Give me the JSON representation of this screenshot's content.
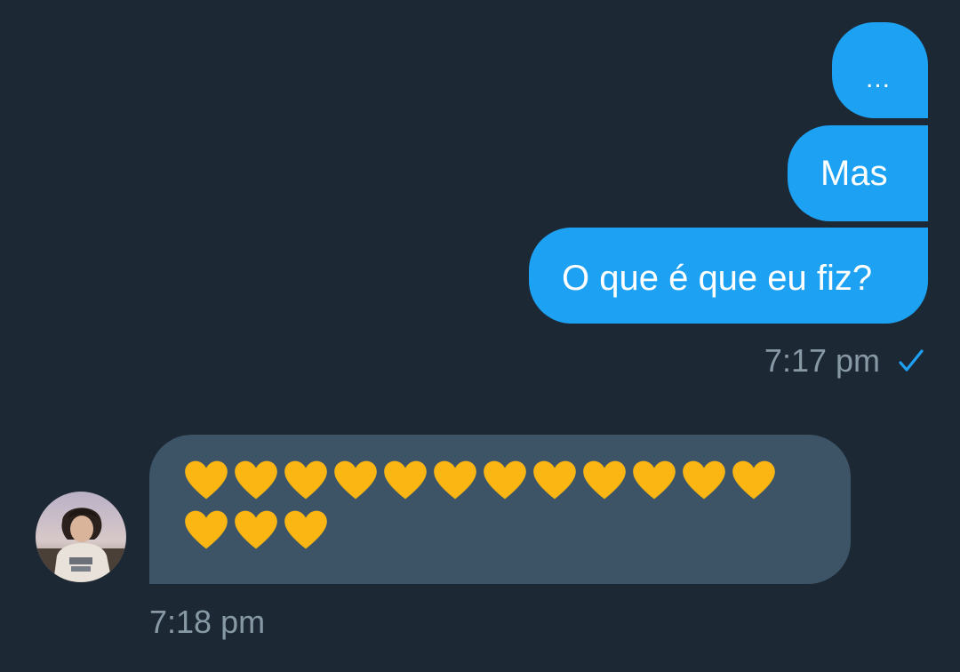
{
  "conversation": {
    "outgoing": {
      "messages": [
        "...",
        "Mas",
        "O que é que eu fiz?"
      ],
      "timestamp": "7:17 pm",
      "status_icon": "check-icon"
    },
    "incoming": {
      "message": "💛💛💛💛💛💛💛💛💛💛💛💛💛💛💛",
      "emoji_name": "yellow-heart-icon",
      "emoji_count": 15,
      "timestamp": "7:18 pm",
      "avatar": "avatar"
    }
  },
  "colors": {
    "background": "#1d2835",
    "outgoing_bubble": "#1da1f2",
    "incoming_bubble": "#3d5466",
    "timestamp": "#8899a6",
    "heart": "#fbb614"
  }
}
